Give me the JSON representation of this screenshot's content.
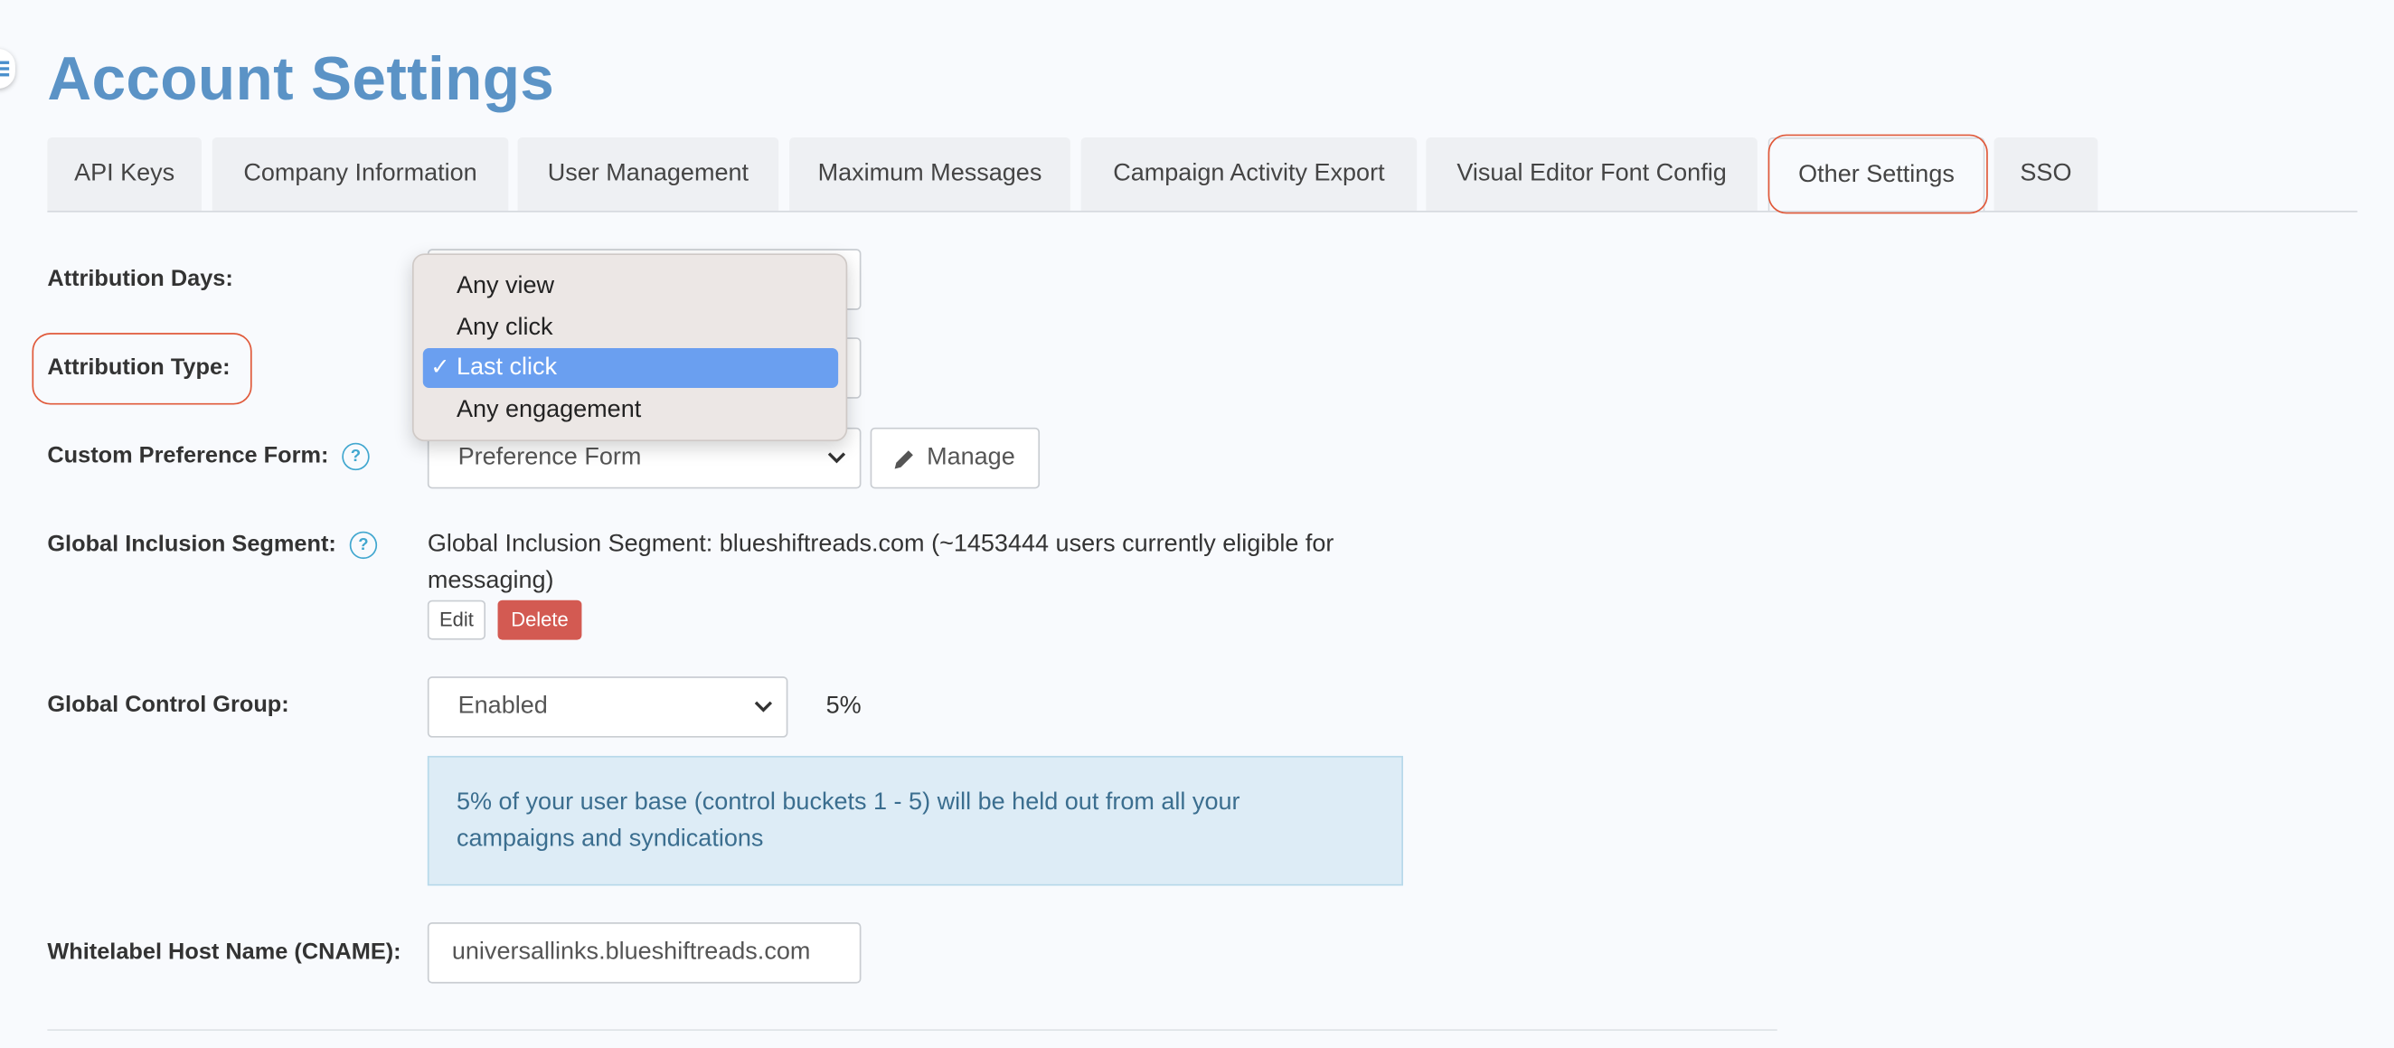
{
  "page": {
    "title": "Account Settings"
  },
  "tabs": [
    {
      "label": "API Keys"
    },
    {
      "label": "Company Information"
    },
    {
      "label": "User Management"
    },
    {
      "label": "Maximum Messages"
    },
    {
      "label": "Campaign Activity Export"
    },
    {
      "label": "Visual Editor Font Config"
    },
    {
      "label": "Other Settings",
      "active": true
    },
    {
      "label": "SSO"
    }
  ],
  "fields": {
    "attribution_days": {
      "label": "Attribution Days:"
    },
    "attribution_type": {
      "label": "Attribution Type:",
      "selected": "Last click",
      "options": [
        "Any view",
        "Any click",
        "Last click",
        "Any engagement"
      ]
    },
    "custom_preference_form": {
      "label": "Custom Preference Form:",
      "help_icon": "?",
      "value": "Preference Form",
      "manage_label": "Manage"
    },
    "global_inclusion_segment": {
      "label": "Global Inclusion Segment:",
      "help_icon": "?",
      "text_line1": "Global Inclusion Segment: blueshiftreads.com (~1453444 users currently eligible for",
      "text_line2": "messaging)",
      "edit_label": "Edit",
      "delete_label": "Delete"
    },
    "global_control_group": {
      "label": "Global Control Group:",
      "value": "Enabled",
      "percent": "5%",
      "info_line1": "5% of your user base (control buckets 1 - 5) will be held out from all your",
      "info_line2": "campaigns and syndications"
    },
    "whitelabel_host": {
      "label": "Whitelabel Host Name (CNAME):",
      "value": "universallinks.blueshiftreads.com"
    }
  },
  "icons": {
    "menu": "hamburger-icon",
    "help": "question-circle-icon",
    "manage": "pencil-icon",
    "check": "✓"
  },
  "colors": {
    "title": "#5b93c6",
    "highlight": "#e0593a",
    "delete": "#d35a52",
    "selected_option": "#6a9ff0",
    "info_bg": "#ddecf6"
  }
}
